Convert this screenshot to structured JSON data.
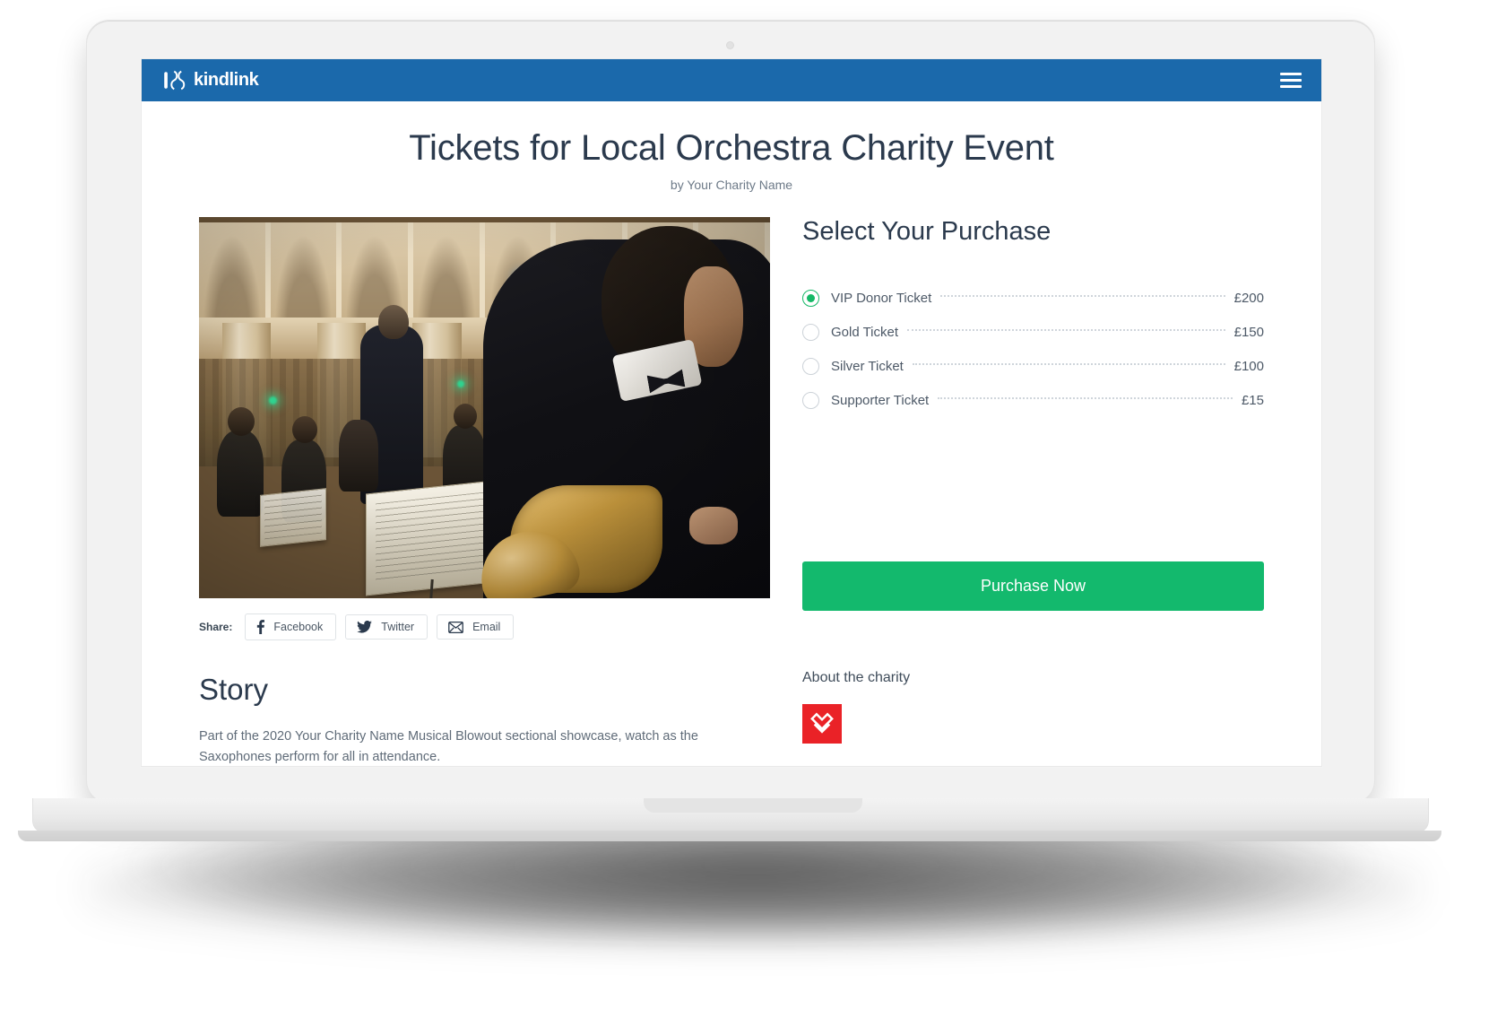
{
  "device": {
    "kind": "laptop-mockup"
  },
  "navbar": {
    "brand_name": "kindlink",
    "brand_icon": "kindlink-logo-icon",
    "menu_icon": "hamburger-menu-icon"
  },
  "header": {
    "title": "Tickets for Local Orchestra Charity Event",
    "subtitle": "by Your Charity Name"
  },
  "hero": {
    "alt": "Orchestra performing in a concert hall, saxophonist in foreground"
  },
  "share": {
    "label": "Share:",
    "buttons": [
      {
        "label": "Facebook",
        "icon": "facebook-icon"
      },
      {
        "label": "Twitter",
        "icon": "twitter-icon"
      },
      {
        "label": "Email",
        "icon": "email-icon"
      }
    ]
  },
  "story": {
    "heading": "Story",
    "body": "Part of the 2020 Your Charity Name Musical Blowout sectional showcase, watch as the Saxophones perform for all in attendance."
  },
  "purchase": {
    "heading": "Select Your Purchase",
    "tickets": [
      {
        "name": "VIP Donor Ticket",
        "price": "£200",
        "selected": true
      },
      {
        "name": "Gold Ticket",
        "price": "£150",
        "selected": false
      },
      {
        "name": "Silver Ticket",
        "price": "£100",
        "selected": false
      },
      {
        "name": "Supporter Ticket",
        "price": "£15",
        "selected": false
      }
    ],
    "button_label": "Purchase Now"
  },
  "about": {
    "heading": "About the charity",
    "logo_icon": "charity-heart-logo-icon"
  },
  "colors": {
    "navbar_blue": "#1b69ab",
    "accent_green": "#13b96d",
    "radio_green": "#14b866",
    "charity_red": "#ea2227",
    "heading_navy": "#2b3a4d",
    "body_text": "#5f6b78"
  }
}
